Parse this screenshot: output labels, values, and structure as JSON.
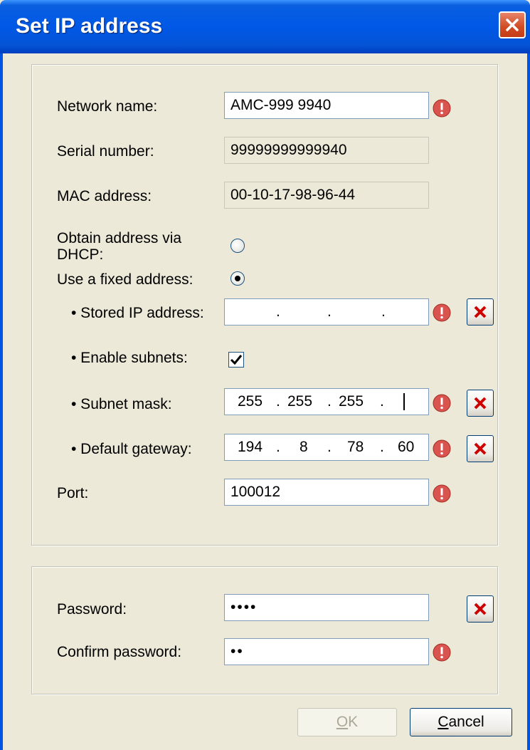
{
  "window": {
    "title": "Set IP address"
  },
  "network": {
    "network_name_label": "Network name:",
    "network_name_value": "AMC-999 9940",
    "serial_label": "Serial number:",
    "serial_value": "99999999999940",
    "mac_label": "MAC address:",
    "mac_value": "00-10-17-98-96-44",
    "dhcp_label": "Obtain address via DHCP:",
    "fixed_label": "Use a fixed address:",
    "stored_ip_label": "• Stored IP address:",
    "stored_ip": [
      "",
      "",
      "",
      ""
    ],
    "subnets_label": "• Enable subnets:",
    "subnet_mask_label": "• Subnet mask:",
    "subnet_mask": [
      "255",
      "255",
      "255",
      ""
    ],
    "gateway_label": "• Default gateway:",
    "gateway": [
      "194",
      "8",
      "78",
      "60"
    ],
    "port_label": "Port:",
    "port_value": "100012"
  },
  "security": {
    "password_label": "Password:",
    "password_value": "••••",
    "confirm_label": "Confirm password:",
    "confirm_value": "••"
  },
  "buttons": {
    "ok_hotkey": "O",
    "ok_rest": "K",
    "cancel_hotkey": "C",
    "cancel_rest": "ancel"
  },
  "dots": {
    "sep": "."
  },
  "colors": {
    "title_bar": "#0058e6",
    "error_icon": "#d9534f",
    "clear_x": "#cc0000"
  }
}
